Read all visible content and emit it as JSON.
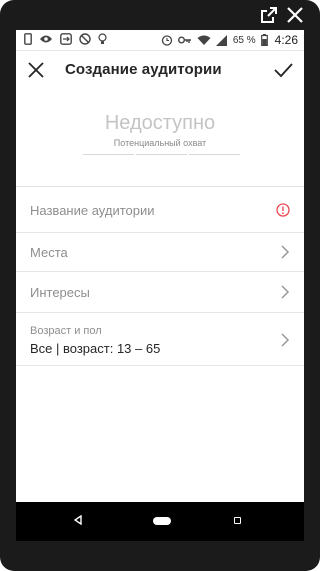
{
  "status_bar": {
    "battery_percent": "65 %",
    "time": "4:26"
  },
  "app_bar": {
    "title": "Создание аудитории"
  },
  "reach": {
    "value": "Недоступно",
    "label": "Потенциальный охват"
  },
  "fields": {
    "audience_name_placeholder": "Название аудитории",
    "places_label": "Места",
    "interests_label": "Интересы",
    "age_gender_label": "Возраст и пол",
    "age_gender_value": "Все | возраст: 13 – 65"
  },
  "colors": {
    "warning": "#ed4956",
    "text_primary": "#262626",
    "text_secondary": "#8e8e8e"
  }
}
